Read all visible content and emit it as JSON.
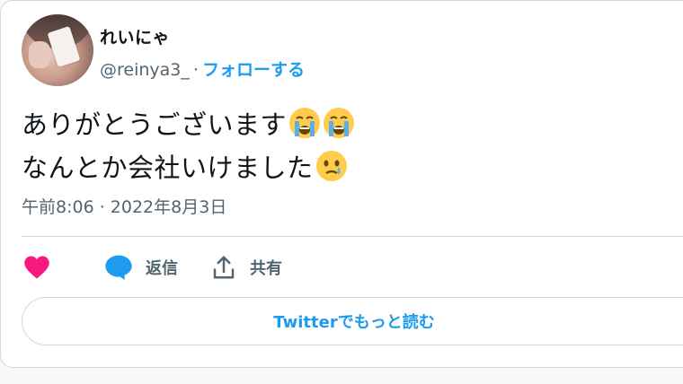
{
  "tweet": {
    "author_name": "れいにゃ",
    "handle": "@reinya3_",
    "separator": "·",
    "follow_label": "フォローする",
    "line1": "ありがとうございます",
    "line1_emoji": [
      "loudly-crying-face",
      "loudly-crying-face"
    ],
    "line2": "なんとか会社いけました",
    "line2_emoji": [
      "face-holding-back-tears"
    ],
    "timestamp": "午前8:06 · 2022年8月3日"
  },
  "actions": {
    "like_icon": "heart-icon",
    "reply_label": "返信",
    "reply_icon": "speech-bubble-icon",
    "share_label": "共有",
    "share_icon": "share-upload-icon"
  },
  "footer": {
    "read_more_label": "Twitterでもっと読む"
  },
  "colors": {
    "accent": "#1d9bf0",
    "like": "#f91880",
    "text_primary": "#0f1419",
    "text_secondary": "#536471",
    "border": "#cfd9de"
  }
}
